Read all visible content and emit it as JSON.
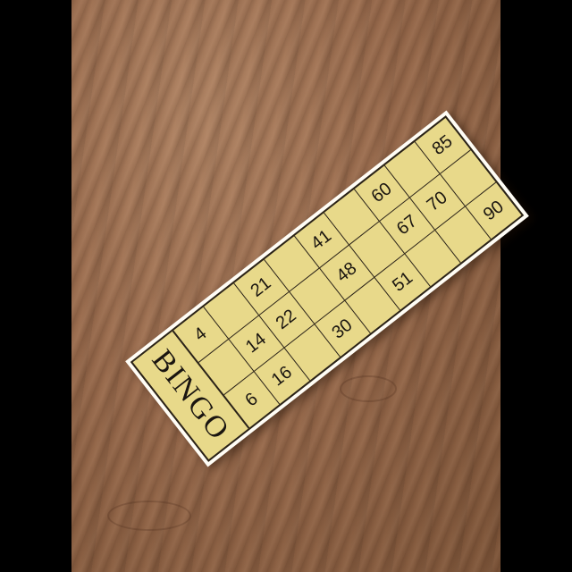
{
  "ticket": {
    "title": "BINGO",
    "rows": [
      [
        "4",
        "",
        "21",
        "",
        "41",
        "",
        "60",
        "",
        "85"
      ],
      [
        "",
        "14",
        "22",
        "",
        "48",
        "",
        "67",
        "70",
        ""
      ],
      [
        "6",
        "16",
        "",
        "30",
        "",
        "51",
        "",
        "",
        "90"
      ]
    ]
  }
}
